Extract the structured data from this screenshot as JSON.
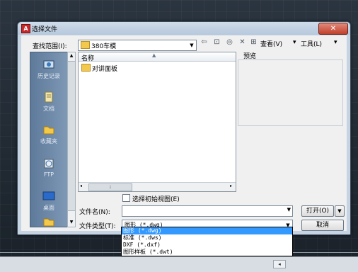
{
  "dialog": {
    "title": "选择文件",
    "close": "✕"
  },
  "toolbar": {
    "look_in_label": "查找范围(I):",
    "look_in_value": "380车模",
    "views_label": "查看(V)",
    "tools_label": "工具(L)",
    "preview_label": "预览"
  },
  "places": [
    {
      "label": "历史记录",
      "icon": "history-icon"
    },
    {
      "label": "文档",
      "icon": "documents-icon"
    },
    {
      "label": "收藏夹",
      "icon": "favorites-icon"
    },
    {
      "label": "FTP",
      "icon": "ftp-icon"
    },
    {
      "label": "桌面",
      "icon": "desktop-icon"
    }
  ],
  "filelist": {
    "column_name": "名称",
    "items": [
      "对讲面板"
    ]
  },
  "form": {
    "initial_view_label": "选择初始视图(E)",
    "filename_label": "文件名(N):",
    "filename_value": "",
    "filetype_label": "文件类型(T):",
    "filetype_value": "图形 (*.dwg)",
    "open_button": "打开(O)",
    "cancel_button": "取消"
  },
  "filetype_options": [
    "图形 (*.dwg)",
    "标准 (*.dws)",
    "DXF (*.dxf)",
    "图形样板 (*.dwt)"
  ],
  "colors": {
    "selection": "#3399ff",
    "close_button": "#c2412c"
  }
}
